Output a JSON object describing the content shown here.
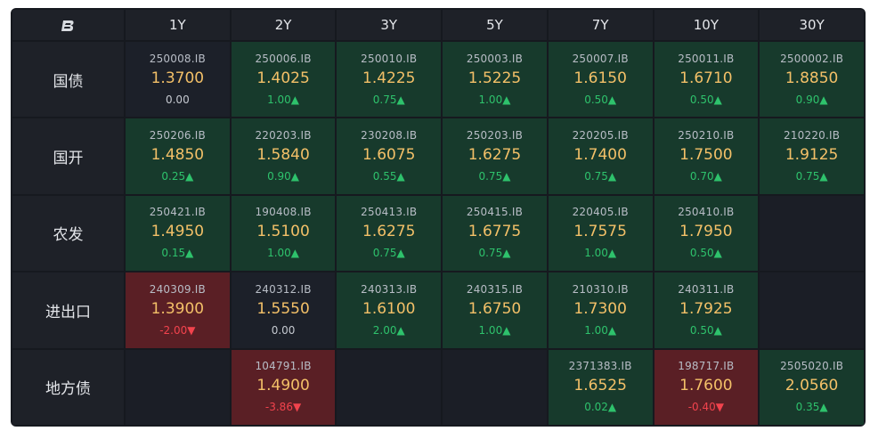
{
  "logo_icon": "logo-b-icon",
  "header": {
    "tenors": [
      "1Y",
      "2Y",
      "3Y",
      "5Y",
      "7Y",
      "10Y",
      "30Y"
    ]
  },
  "colors": {
    "green_bg": "#173a2c",
    "red_bg": "#5a1f25",
    "neutral_bg": "#1c2029",
    "yield_text": "#f3c068",
    "up": "#2ec26c",
    "down": "#f2434d"
  },
  "rows": [
    {
      "label": "国债",
      "cells": [
        {
          "code": "250008.IB",
          "yield": "1.3700",
          "change": "0.00",
          "arrow": "",
          "dir": "flat"
        },
        {
          "code": "250006.IB",
          "yield": "1.4025",
          "change": "1.00",
          "arrow": "▲",
          "dir": "up"
        },
        {
          "code": "250010.IB",
          "yield": "1.4225",
          "change": "0.75",
          "arrow": "▲",
          "dir": "up"
        },
        {
          "code": "250003.IB",
          "yield": "1.5225",
          "change": "1.00",
          "arrow": "▲",
          "dir": "up"
        },
        {
          "code": "250007.IB",
          "yield": "1.6150",
          "change": "0.50",
          "arrow": "▲",
          "dir": "up"
        },
        {
          "code": "250011.IB",
          "yield": "1.6710",
          "change": "0.50",
          "arrow": "▲",
          "dir": "up"
        },
        {
          "code": "2500002.IB",
          "yield": "1.8850",
          "change": "0.90",
          "arrow": "▲",
          "dir": "up"
        }
      ]
    },
    {
      "label": "国开",
      "cells": [
        {
          "code": "250206.IB",
          "yield": "1.4850",
          "change": "0.25",
          "arrow": "▲",
          "dir": "up"
        },
        {
          "code": "220203.IB",
          "yield": "1.5840",
          "change": "0.90",
          "arrow": "▲",
          "dir": "up"
        },
        {
          "code": "230208.IB",
          "yield": "1.6075",
          "change": "0.55",
          "arrow": "▲",
          "dir": "up"
        },
        {
          "code": "250203.IB",
          "yield": "1.6275",
          "change": "0.75",
          "arrow": "▲",
          "dir": "up"
        },
        {
          "code": "220205.IB",
          "yield": "1.7400",
          "change": "0.75",
          "arrow": "▲",
          "dir": "up"
        },
        {
          "code": "250210.IB",
          "yield": "1.7500",
          "change": "0.70",
          "arrow": "▲",
          "dir": "up"
        },
        {
          "code": "210220.IB",
          "yield": "1.9125",
          "change": "0.75",
          "arrow": "▲",
          "dir": "up"
        }
      ]
    },
    {
      "label": "农发",
      "cells": [
        {
          "code": "250421.IB",
          "yield": "1.4950",
          "change": "0.15",
          "arrow": "▲",
          "dir": "up"
        },
        {
          "code": "190408.IB",
          "yield": "1.5100",
          "change": "1.00",
          "arrow": "▲",
          "dir": "up"
        },
        {
          "code": "250413.IB",
          "yield": "1.6275",
          "change": "0.75",
          "arrow": "▲",
          "dir": "up"
        },
        {
          "code": "250415.IB",
          "yield": "1.6775",
          "change": "0.75",
          "arrow": "▲",
          "dir": "up"
        },
        {
          "code": "220405.IB",
          "yield": "1.7575",
          "change": "1.00",
          "arrow": "▲",
          "dir": "up"
        },
        {
          "code": "250410.IB",
          "yield": "1.7950",
          "change": "0.50",
          "arrow": "▲",
          "dir": "up"
        },
        null
      ]
    },
    {
      "label": "进出口",
      "cells": [
        {
          "code": "240309.IB",
          "yield": "1.3900",
          "change": "-2.00",
          "arrow": "▼",
          "dir": "down"
        },
        {
          "code": "240312.IB",
          "yield": "1.5550",
          "change": "0.00",
          "arrow": "",
          "dir": "flat"
        },
        {
          "code": "240313.IB",
          "yield": "1.6100",
          "change": "2.00",
          "arrow": "▲",
          "dir": "up"
        },
        {
          "code": "240315.IB",
          "yield": "1.6750",
          "change": "1.00",
          "arrow": "▲",
          "dir": "up"
        },
        {
          "code": "210310.IB",
          "yield": "1.7300",
          "change": "1.00",
          "arrow": "▲",
          "dir": "up"
        },
        {
          "code": "240311.IB",
          "yield": "1.7925",
          "change": "0.50",
          "arrow": "▲",
          "dir": "up"
        },
        null
      ]
    },
    {
      "label": "地方债",
      "cells": [
        null,
        {
          "code": "104791.IB",
          "yield": "1.4900",
          "change": "-3.86",
          "arrow": "▼",
          "dir": "down"
        },
        null,
        null,
        {
          "code": "2371383.IB",
          "yield": "1.6525",
          "change": "0.02",
          "arrow": "▲",
          "dir": "up"
        },
        {
          "code": "198717.IB",
          "yield": "1.7600",
          "change": "-0.40",
          "arrow": "▼",
          "dir": "down"
        },
        {
          "code": "2505020.IB",
          "yield": "2.0560",
          "change": "0.35",
          "arrow": "▲",
          "dir": "up"
        }
      ]
    }
  ]
}
